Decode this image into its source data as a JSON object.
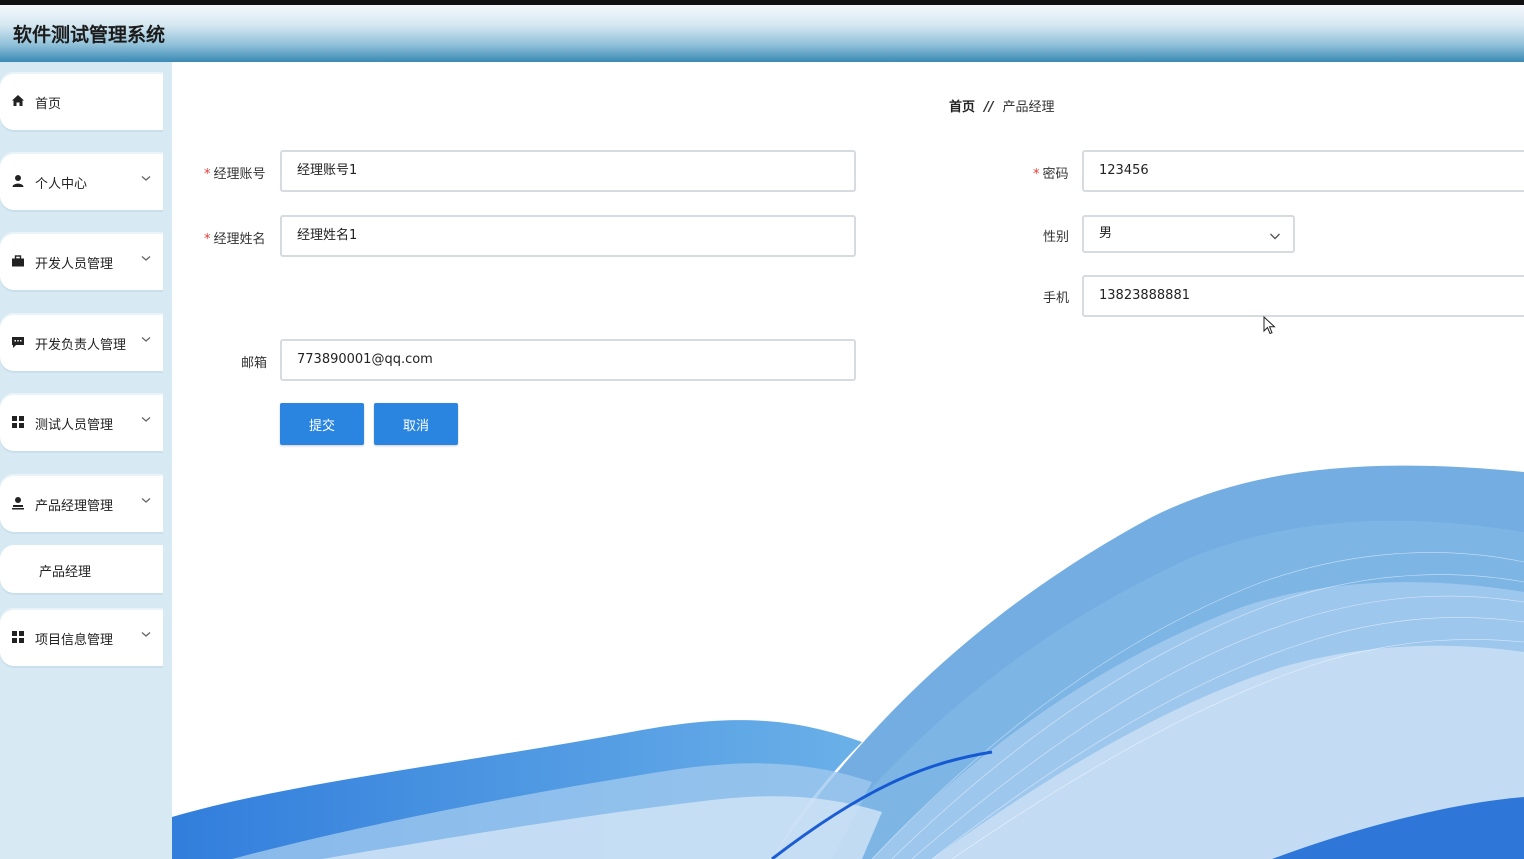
{
  "app": {
    "title": "软件测试管理系统"
  },
  "sidebar": {
    "items": [
      {
        "label": "首页",
        "icon": "home-icon",
        "has_children": false
      },
      {
        "label": "个人中心",
        "icon": "user-icon",
        "has_children": true
      },
      {
        "label": "开发人员管理",
        "icon": "briefcase-icon",
        "has_children": true
      },
      {
        "label": "开发负责人管理",
        "icon": "chat-icon",
        "has_children": true
      },
      {
        "label": "测试人员管理",
        "icon": "grid-icon",
        "has_children": true
      },
      {
        "label": "产品经理管理",
        "icon": "person-icon",
        "has_children": true
      },
      {
        "label": "项目信息管理",
        "icon": "grid-icon",
        "has_children": true
      }
    ],
    "submenu": {
      "label": "产品经理"
    }
  },
  "breadcrumb": {
    "home": "首页",
    "separator": "//",
    "current": "产品经理"
  },
  "form": {
    "account": {
      "label": "经理账号",
      "value": "经理账号1",
      "required": true
    },
    "password": {
      "label": "密码",
      "value": "123456",
      "required": true
    },
    "name": {
      "label": "经理姓名",
      "value": "经理姓名1",
      "required": true
    },
    "gender": {
      "label": "性别",
      "value": "男"
    },
    "phone": {
      "label": "手机",
      "value": "13823888881"
    },
    "email": {
      "label": "邮箱",
      "value": "773890001@qq.com"
    },
    "required_mark": "*"
  },
  "buttons": {
    "submit": "提交",
    "cancel": "取消"
  },
  "colors": {
    "primary": "#2a85e0",
    "sidebar_bg": "#d7eaf4",
    "required": "#e53935"
  }
}
